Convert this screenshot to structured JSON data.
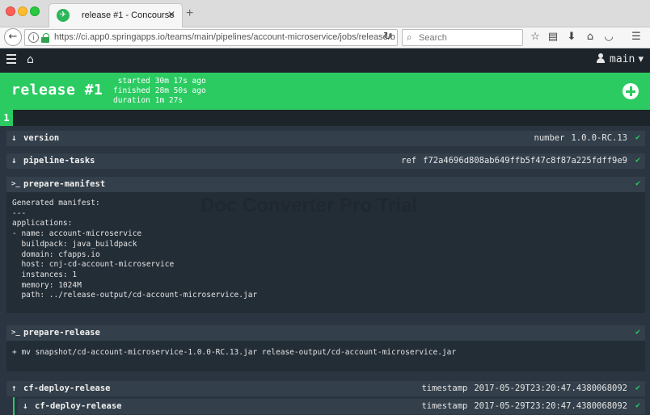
{
  "browser": {
    "tab_title": "release #1 - Concourse",
    "tab_close": "✕",
    "new_tab": "+",
    "url": "https://ci.app0.springapps.io/teams/main/pipelines/account-microservice/jobs/release/b",
    "search_placeholder": "Search"
  },
  "topbar": {
    "user_label": "main",
    "user_caret": "▾"
  },
  "build": {
    "name": "release #1",
    "started_label": "started",
    "started_value": "30m 17s ago",
    "finished_label": "finished",
    "finished_value": "28m 50s ago",
    "duration_label": "duration",
    "duration_value": "1m 27s",
    "tab_number": "1"
  },
  "steps": [
    {
      "icon": "down-arrow-icon",
      "name": "version",
      "meta_key": "number",
      "meta_value": "1.0.0-RC.13",
      "status": "succeeded"
    },
    {
      "icon": "down-arrow-icon",
      "name": "pipeline-tasks",
      "meta_key": "ref",
      "meta_value": "f72a4696d808ab649ffb5f47c8f87a225fdff9e9",
      "status": "succeeded"
    },
    {
      "icon": "terminal-icon",
      "name": "prepare-manifest",
      "meta_key": "",
      "meta_value": "",
      "status": "succeeded"
    },
    {
      "icon": "terminal-icon",
      "name": "prepare-release",
      "meta_key": "",
      "meta_value": "",
      "status": "succeeded"
    },
    {
      "icon": "up-arrow-icon",
      "name": "cf-deploy-release",
      "meta_key": "timestamp",
      "meta_value": "2017-05-29T23:20:47.4380068092",
      "status": "succeeded"
    },
    {
      "icon": "down-arrow-icon",
      "name": "cf-deploy-release",
      "meta_key": "timestamp",
      "meta_value": "2017-05-29T23:20:47.4380068092",
      "status": "succeeded"
    }
  ],
  "logs": {
    "prepare_manifest": "Generated manifest:\n---\napplications:\n- name: account-microservice\n  buildpack: java_buildpack\n  domain: cfapps.io\n  host: cnj-cd-account-microservice\n  instances: 1\n  memory: 1024M\n  path: ../release-output/cd-account-microservice.jar",
    "prepare_release": "+ mv snapshot/cd-account-microservice-1.0.0-RC.13.jar release-output/cd-account-microservice.jar"
  },
  "watermark": "Doc Converter Pro Trial",
  "colors": {
    "success_green": "#2bcb62",
    "topbar": "#1d252b",
    "step_header": "#333f4a",
    "log_bg": "#232d36",
    "page_bg": "#2a3541"
  }
}
